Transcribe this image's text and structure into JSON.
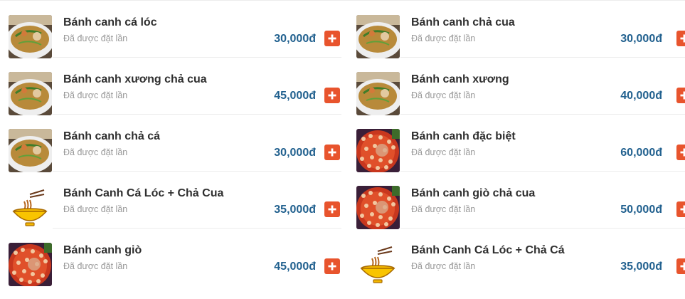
{
  "menu": {
    "left": [
      {
        "name": "Bánh canh cá lóc",
        "note": "Đã được đặt lần",
        "price": "30,000đ",
        "image": "soup-bowl-photo"
      },
      {
        "name": "Bánh canh xương chả cua",
        "note": "Đã được đặt lần",
        "price": "45,000đ",
        "image": "soup-bowl-photo"
      },
      {
        "name": "Bánh canh chả cá",
        "note": "Đã được đặt lần",
        "price": "30,000đ",
        "image": "soup-bowl-photo"
      },
      {
        "name": "Bánh Canh Cá Lóc + Chả Cua",
        "note": "Đã được đặt lần",
        "price": "35,000đ",
        "image": "noodle-bowl-icon"
      },
      {
        "name": "Bánh canh giò",
        "note": "Đã được đặt lần",
        "price": "45,000đ",
        "image": "red-broth-pot-photo"
      }
    ],
    "right": [
      {
        "name": "Bánh canh chả cua",
        "note": "Đã được đặt lần",
        "price": "30,000đ",
        "image": "soup-bowl-photo"
      },
      {
        "name": "Bánh canh xương",
        "note": "Đã được đặt lần",
        "price": "40,000đ",
        "image": "soup-bowl-photo"
      },
      {
        "name": "Bánh canh đặc biệt",
        "note": "Đã được đặt lần",
        "price": "60,000đ",
        "image": "red-broth-pot-photo"
      },
      {
        "name": "Bánh canh giò chả cua",
        "note": "Đã được đặt lần",
        "price": "50,000đ",
        "image": "red-broth-pot-photo"
      },
      {
        "name": "Bánh Canh Cá Lóc + Chả Cá",
        "note": "Đã được đặt lần",
        "price": "35,000đ",
        "image": "noodle-bowl-icon"
      }
    ]
  },
  "colors": {
    "price": "#22618f",
    "add_button": "#e8542d",
    "title": "#2e2e2e",
    "note": "#999999"
  },
  "icons": {
    "add": "plus-icon"
  }
}
